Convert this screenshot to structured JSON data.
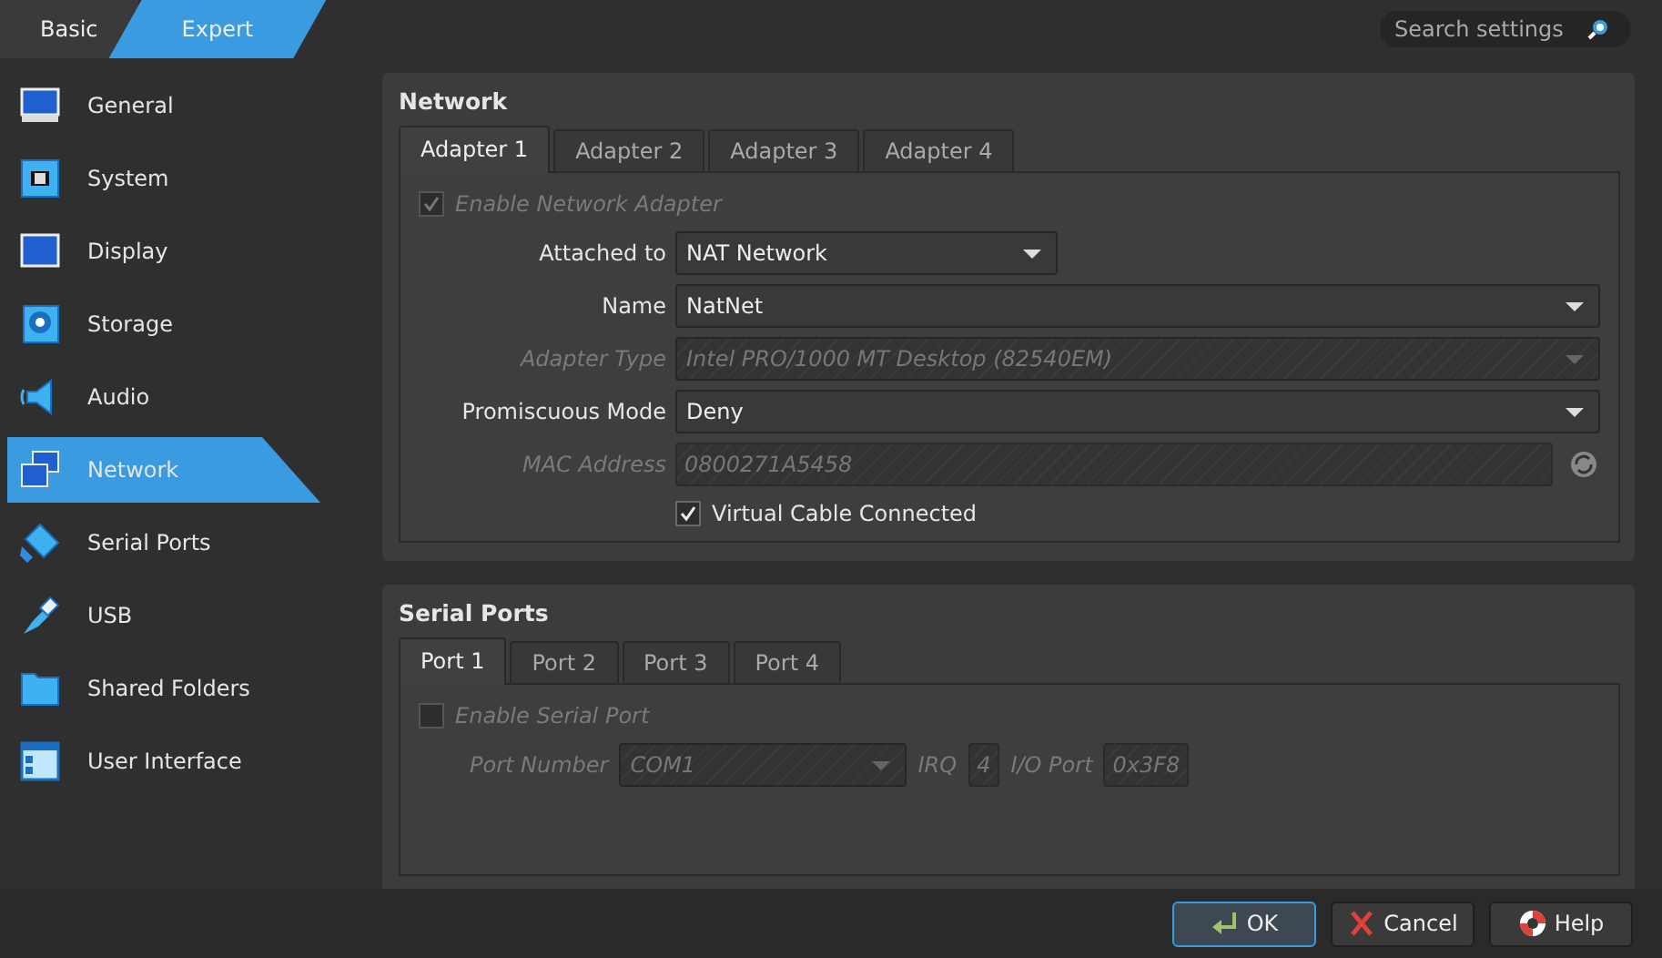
{
  "mode_tabs": [
    {
      "label": "Basic",
      "selected": false
    },
    {
      "label": "Expert",
      "selected": true
    }
  ],
  "search": {
    "placeholder": "Search settings"
  },
  "sidebar": {
    "items": [
      {
        "label": "General",
        "kind": "general",
        "selected": false
      },
      {
        "label": "System",
        "kind": "system",
        "selected": false
      },
      {
        "label": "Display",
        "kind": "display",
        "selected": false
      },
      {
        "label": "Storage",
        "kind": "storage",
        "selected": false
      },
      {
        "label": "Audio",
        "kind": "audio",
        "selected": false
      },
      {
        "label": "Network",
        "kind": "network",
        "selected": true
      },
      {
        "label": "Serial Ports",
        "kind": "serial",
        "selected": false
      },
      {
        "label": "USB",
        "kind": "usb",
        "selected": false
      },
      {
        "label": "Shared Folders",
        "kind": "folder",
        "selected": false
      },
      {
        "label": "User Interface",
        "kind": "ui",
        "selected": false
      }
    ]
  },
  "network": {
    "title": "Network",
    "tabs": [
      {
        "label": "Adapter 1",
        "selected": true
      },
      {
        "label": "Adapter 2",
        "selected": false
      },
      {
        "label": "Adapter 3",
        "selected": false
      },
      {
        "label": "Adapter 4",
        "selected": false
      }
    ],
    "enable": {
      "label": "Enable Network Adapter",
      "checked": true,
      "disabled": true
    },
    "rows": [
      {
        "kind": "combo",
        "label": "Attached to",
        "value": "NAT Network",
        "disabled": false
      },
      {
        "kind": "combo",
        "label": "Name",
        "value": "NatNet",
        "disabled": false
      },
      {
        "kind": "combo",
        "label": "Adapter Type",
        "value": "Intel PRO/1000 MT Desktop (82540EM)",
        "disabled": true
      },
      {
        "kind": "combo",
        "label": "Promiscuous Mode",
        "value": "Deny",
        "disabled": false
      },
      {
        "kind": "field",
        "label": "MAC Address",
        "value": "0800271A5458",
        "disabled": true
      }
    ],
    "cable": {
      "label": "Virtual Cable Connected",
      "checked": true,
      "disabled": false
    }
  },
  "serial": {
    "title": "Serial Ports",
    "tabs": [
      {
        "label": "Port 1",
        "selected": true
      },
      {
        "label": "Port 2",
        "selected": false
      },
      {
        "label": "Port 3",
        "selected": false
      },
      {
        "label": "Port 4",
        "selected": false
      }
    ],
    "enable": {
      "label": "Enable Serial Port",
      "checked": false,
      "disabled": true
    },
    "port_number": {
      "label": "Port Number",
      "value": "COM1",
      "disabled": true
    },
    "irq": {
      "label": "IRQ",
      "value": "4",
      "disabled": true
    },
    "io_port": {
      "label": "I/O Port",
      "value": "0x3F8",
      "disabled": true
    }
  },
  "buttons": [
    {
      "label": "OK",
      "kind": "ok"
    },
    {
      "label": "Cancel",
      "kind": "cancel"
    },
    {
      "label": "Help",
      "kind": "help"
    }
  ]
}
